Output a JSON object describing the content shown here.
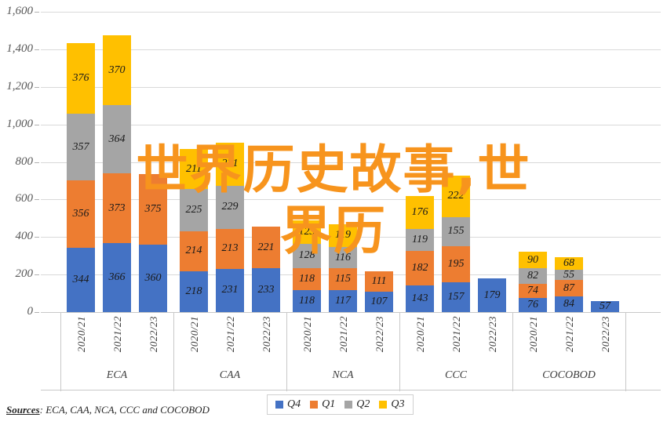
{
  "chart_data": {
    "type": "bar",
    "subtype": "stacked-grouped-column",
    "title": "",
    "xlabel": "",
    "ylabel": "",
    "ylim": [
      0,
      1600
    ],
    "ytick_step": 200,
    "ytick_labels": [
      "0",
      "200",
      "400",
      "600",
      "800",
      "1,000",
      "1,200",
      "1,400",
      "1,600"
    ],
    "grid": true,
    "legend_position": "bottom-center",
    "series": [
      {
        "name": "Q4",
        "color": "#4472c4"
      },
      {
        "name": "Q1",
        "color": "#ed7d31"
      },
      {
        "name": "Q2",
        "color": "#a5a5a5"
      },
      {
        "name": "Q3",
        "color": "#ffc000"
      }
    ],
    "groups": [
      {
        "label": "ECA",
        "periods": [
          {
            "label": "2020/21",
            "Q4": 344,
            "Q1": 356,
            "Q2": 357,
            "Q3": 376
          },
          {
            "label": "2021/22",
            "Q4": 366,
            "Q1": 373,
            "Q2": 364,
            "Q3": 370
          },
          {
            "label": "2022/23",
            "Q4": 360,
            "Q1": 375,
            "Q2": 0,
            "Q3": 0
          }
        ]
      },
      {
        "label": "CAA",
        "periods": [
          {
            "label": "2020/21",
            "Q4": 218,
            "Q1": 214,
            "Q2": 225,
            "Q3": 211
          },
          {
            "label": "2021/22",
            "Q4": 231,
            "Q1": 213,
            "Q2": 229,
            "Q3": 231
          },
          {
            "label": "2022/23",
            "Q4": 233,
            "Q1": 221,
            "Q2": 0,
            "Q3": 0
          }
        ]
      },
      {
        "label": "NCA",
        "periods": [
          {
            "label": "2020/21",
            "Q4": 118,
            "Q1": 118,
            "Q2": 128,
            "Q3": 123
          },
          {
            "label": "2021/22",
            "Q4": 117,
            "Q1": 115,
            "Q2": 116,
            "Q3": 119
          },
          {
            "label": "2022/23",
            "Q4": 107,
            "Q1": 111,
            "Q2": 0,
            "Q3": 0
          }
        ]
      },
      {
        "label": "CCC",
        "periods": [
          {
            "label": "2020/21",
            "Q4": 143,
            "Q1": 182,
            "Q2": 119,
            "Q3": 176
          },
          {
            "label": "2021/22",
            "Q4": 157,
            "Q1": 195,
            "Q2": 155,
            "Q3": 222
          },
          {
            "label": "2022/23",
            "Q4": 179,
            "Q1": 0,
            "Q2": 0,
            "Q3": 0
          }
        ]
      },
      {
        "label": "COCOBOD",
        "periods": [
          {
            "label": "2020/21",
            "Q4": 76,
            "Q1": 74,
            "Q2": 82,
            "Q3": 90
          },
          {
            "label": "2021/22",
            "Q4": 84,
            "Q1": 87,
            "Q2": 55,
            "Q3": 68
          },
          {
            "label": "2022/23",
            "Q4": 57,
            "Q1": 0,
            "Q2": 0,
            "Q3": 0
          }
        ]
      }
    ]
  },
  "legend": {
    "items": [
      {
        "label": "Q4",
        "color": "#4472c4"
      },
      {
        "label": "Q1",
        "color": "#ed7d31"
      },
      {
        "label": "Q2",
        "color": "#a5a5a5"
      },
      {
        "label": "Q3",
        "color": "#ffc000"
      }
    ]
  },
  "source": {
    "prefix": "Sources",
    "text": ": ECA, CAA, NCA, CCC and COCOBOD"
  },
  "overlay": {
    "line1": "世界历史故事,世",
    "line2": "界历"
  },
  "colors": {
    "q4": "#4472c4",
    "q1": "#ed7d31",
    "q2": "#a5a5a5",
    "q3": "#ffc000",
    "gridline": "#d9d9d9",
    "overlay_text": "#f7941d"
  }
}
